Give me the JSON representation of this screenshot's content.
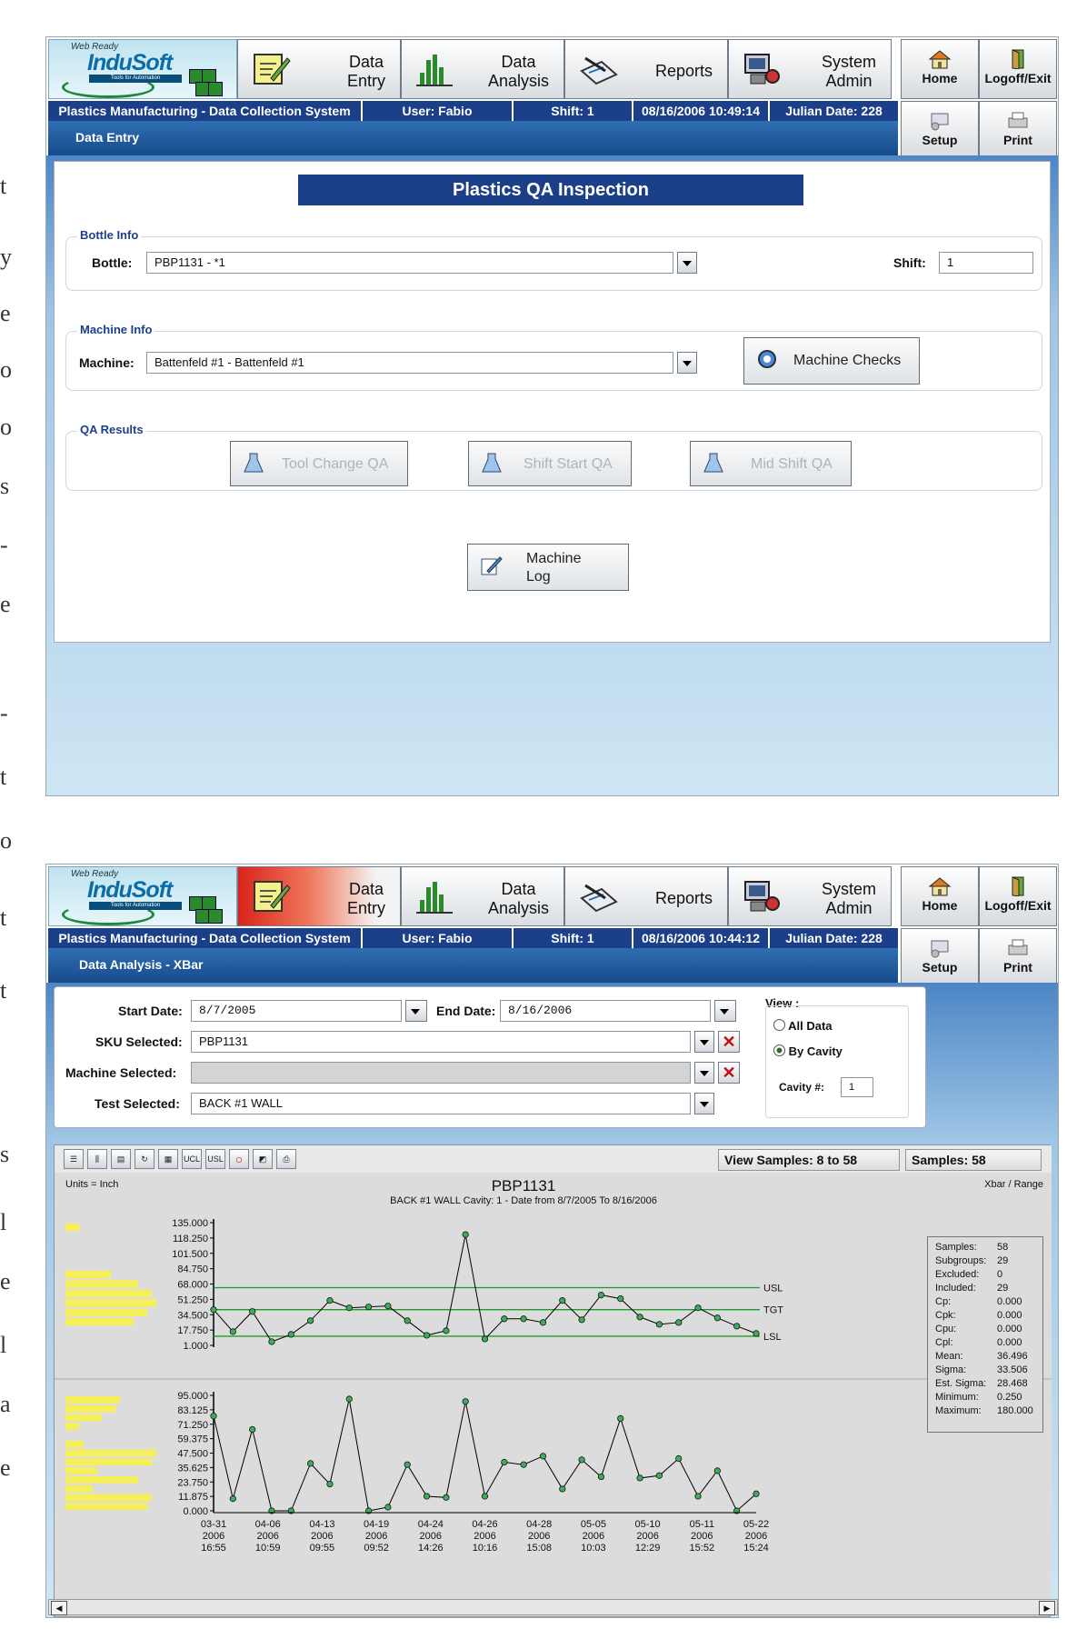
{
  "edge_text": [
    "t",
    "y",
    "e",
    "o",
    "o",
    "s",
    "-",
    "e",
    "-",
    "t",
    "o",
    "t",
    "t",
    "s",
    "l",
    "e",
    "l",
    "a",
    "e"
  ],
  "brand": {
    "tagline": "Web Ready",
    "name": "InduSoft",
    "sub": "Tools for Automation"
  },
  "nav": {
    "data_entry": "Data\nEntry",
    "data_analysis": "Data\nAnalysis",
    "reports": "Reports",
    "system_admin": "System\nAdmin",
    "home": "Home",
    "logoff": "Logoff/Exit",
    "setup": "Setup",
    "print": "Print"
  },
  "screen1": {
    "status": {
      "system": "Plastics Manufacturing - Data Collection System",
      "user": "User: Fabio",
      "shift": "Shift: 1",
      "datetime": "08/16/2006 10:49:14",
      "julian": "Julian Date: 228"
    },
    "subtitle": "Data Entry",
    "title": "Plastics QA Inspection",
    "bottle_info": {
      "legend": "Bottle Info",
      "bottle_label": "Bottle:",
      "bottle_value": "PBP1131 - *1",
      "shift_label": "Shift:",
      "shift_value": "1"
    },
    "machine_info": {
      "legend": "Machine Info",
      "machine_label": "Machine:",
      "machine_value": "Battenfeld #1 - Battenfeld #1",
      "checks_button": "Machine Checks"
    },
    "qa_results": {
      "legend": "QA Results",
      "tool_change": "Tool Change QA",
      "shift_start": "Shift Start QA",
      "mid_shift": "Mid Shift QA"
    },
    "machine_log": "Machine\nLog"
  },
  "screen2": {
    "status": {
      "system": "Plastics Manufacturing - Data Collection System",
      "user": "User: Fabio",
      "shift": "Shift: 1",
      "datetime": "08/16/2006 10:44:12",
      "julian": "Julian Date: 228"
    },
    "subtitle": "Data Analysis  - XBar",
    "filters": {
      "start_label": "Start Date:",
      "start_value": "8/7/2005",
      "end_label": "End Date:",
      "end_value": "8/16/2006",
      "sku_label": "SKU Selected:",
      "sku_value": "PBP1131",
      "machine_label": "Machine Selected:",
      "machine_value": "",
      "test_label": "Test Selected:",
      "test_value": "BACK #1 WALL"
    },
    "view": {
      "label": "View :",
      "all": "All Data",
      "cavity": "By Cavity",
      "cavity_label": "Cavity #:",
      "cavity_value": "1"
    },
    "toolbar_icons": [
      "settings-icon",
      "bars-icon",
      "table-icon",
      "refresh-icon",
      "histogram-icon",
      "ucl-icon",
      "usl-icon",
      "circle-icon",
      "chart-icon",
      "print-icon"
    ],
    "view_samples": "View Samples: 8 to 58",
    "samples": "Samples: 58",
    "chart_header": {
      "units": "Units = Inch",
      "title": "PBP1131",
      "subtitle": "BACK #1 WALL Cavity: 1 - Date from 8/7/2005 To 8/16/2006",
      "mode": "Xbar / Range"
    },
    "stats": [
      {
        "k": "Samples:",
        "v": "58"
      },
      {
        "k": "Subgroups:",
        "v": "29"
      },
      {
        "k": "Excluded:",
        "v": "0"
      },
      {
        "k": "Included:",
        "v": "29"
      },
      {
        "k": "Cp:",
        "v": "0.000"
      },
      {
        "k": "Cpk:",
        "v": "0.000"
      },
      {
        "k": "Cpu:",
        "v": "0.000"
      },
      {
        "k": "Cpl:",
        "v": "0.000"
      },
      {
        "k": "Mean:",
        "v": "36.496"
      },
      {
        "k": "Sigma:",
        "v": "33.506"
      },
      {
        "k": "Est. Sigma:",
        "v": "28.468"
      },
      {
        "k": "Minimum:",
        "v": "0.250"
      },
      {
        "k": "Maximum:",
        "v": "180.000"
      }
    ]
  },
  "chart_data": [
    {
      "type": "line",
      "title": "PBP1131",
      "subtitle": "BACK #1 WALL Cavity: 1 - Date from 8/7/2005 To 8/16/2006",
      "yticks": [
        "135.000",
        "118.250",
        "101.500",
        "84.750",
        "68.000",
        "51.250",
        "34.500",
        "17.750",
        "1.000"
      ],
      "ylim": [
        1,
        135
      ],
      "limits": [
        {
          "name": "USL",
          "value": 64
        },
        {
          "name": "TGT",
          "value": 40
        },
        {
          "name": "LSL",
          "value": 11
        }
      ],
      "series": [
        {
          "values": [
            40,
            16,
            38,
            5,
            13,
            28,
            50,
            42,
            43,
            44,
            28,
            12,
            17,
            122,
            8,
            30,
            30,
            26,
            50,
            29,
            56,
            52,
            32,
            24,
            26,
            42,
            31,
            22,
            14
          ]
        }
      ],
      "histogram": [
        0.15,
        0,
        0,
        0,
        0,
        0.5,
        0.8,
        0.95,
        1,
        0.9,
        0.75,
        0,
        0
      ]
    },
    {
      "type": "line",
      "yticks": [
        "95.000",
        "83.125",
        "71.250",
        "59.375",
        "47.500",
        "35.625",
        "23.750",
        "11.875",
        "0.000"
      ],
      "ylim": [
        0,
        95
      ],
      "series": [
        {
          "values": [
            78,
            10,
            67,
            0,
            0,
            39,
            22,
            92,
            0,
            3,
            38,
            12,
            11,
            90,
            12,
            40,
            38,
            45,
            18,
            42,
            28,
            76,
            27,
            29,
            43,
            12,
            33,
            0,
            14
          ]
        }
      ],
      "xticks": [
        {
          "d": "03-31",
          "y": "2006",
          "t": "16:55"
        },
        {
          "d": "04-06",
          "y": "2006",
          "t": "10:59"
        },
        {
          "d": "04-13",
          "y": "2006",
          "t": "09:55"
        },
        {
          "d": "04-19",
          "y": "2006",
          "t": "09:52"
        },
        {
          "d": "04-24",
          "y": "2006",
          "t": "14:26"
        },
        {
          "d": "04-26",
          "y": "2006",
          "t": "10:16"
        },
        {
          "d": "04-28",
          "y": "2006",
          "t": "15:08"
        },
        {
          "d": "05-05",
          "y": "2006",
          "t": "10:03"
        },
        {
          "d": "05-10",
          "y": "2006",
          "t": "12:29"
        },
        {
          "d": "05-11",
          "y": "2006",
          "t": "15:52"
        },
        {
          "d": "05-22",
          "y": "2006",
          "t": "15:24"
        }
      ],
      "histogram": [
        0.6,
        0.55,
        0.4,
        0.15,
        0,
        0.2,
        1,
        0.95,
        0.35,
        0.8,
        0.3,
        0.95,
        0.9
      ]
    }
  ]
}
